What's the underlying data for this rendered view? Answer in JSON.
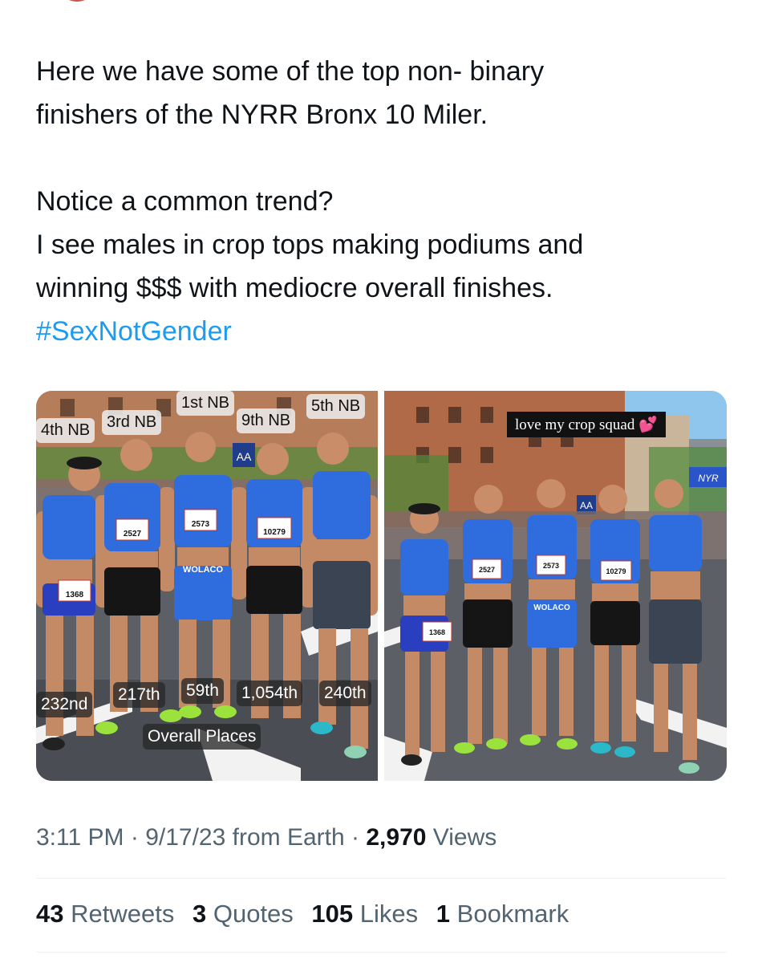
{
  "tweet": {
    "lines": [
      "Here we have some of the top non- binary",
      "finishers of the NYRR Bronx 10 Miler.",
      "Notice a common trend?",
      "I see males in crop tops making podiums and",
      "winning $$$ with mediocre overall finishes."
    ],
    "hashtag": "#SexNotGender"
  },
  "media": {
    "left": {
      "labels_top": [
        "4th NB",
        "3rd NB",
        "1st NB",
        "9th NB",
        "5th NB"
      ],
      "labels_bottom": [
        "232nd",
        "217th",
        "59th",
        "1,054th",
        "240th"
      ],
      "caption": "Overall Places",
      "bibs": [
        "1368",
        "2527",
        "2573",
        "10279"
      ],
      "sponsor": "WOLACO",
      "sign": "AA"
    },
    "right": {
      "caption": "love my crop squad 💕",
      "bibs": [
        "1368",
        "2527",
        "2573",
        "10279"
      ],
      "sponsor": "WOLACO",
      "sign": "AA",
      "flag": "NYR"
    }
  },
  "meta": {
    "time": "3:11 PM",
    "sep1": "·",
    "date": "9/17/23",
    "source": "from Earth",
    "sep2": "·",
    "views_count": "2,970",
    "views_label": "Views"
  },
  "stats": {
    "retweets_count": "43",
    "retweets_label": "Retweets",
    "quotes_count": "3",
    "quotes_label": "Quotes",
    "likes_count": "105",
    "likes_label": "Likes",
    "bookmarks_count": "1",
    "bookmarks_label": "Bookmark"
  },
  "colors": {
    "hashtag": "#1d9bf0",
    "singlet": "#1f4fd0",
    "meta_text": "#536471"
  }
}
